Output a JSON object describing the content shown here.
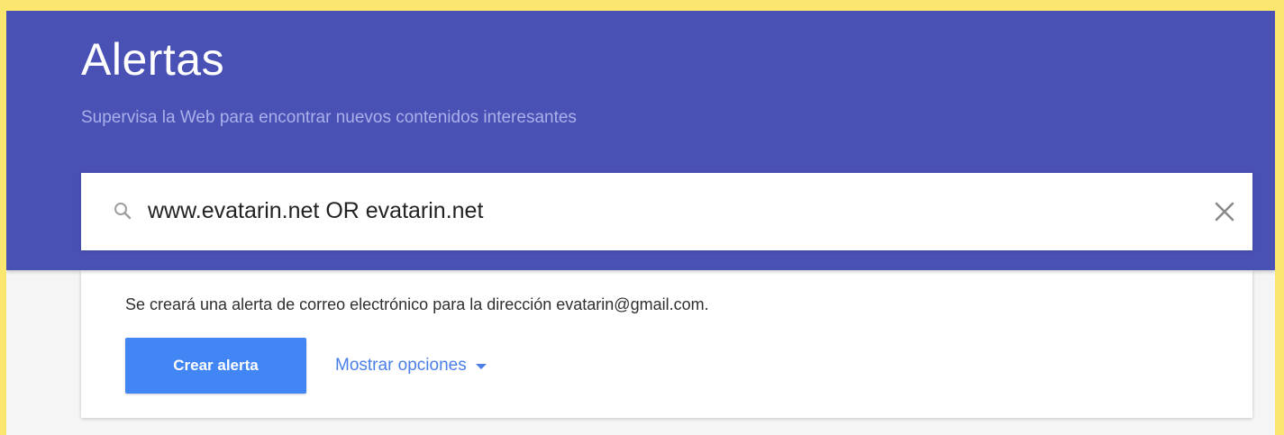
{
  "header": {
    "title": "Alertas",
    "subtitle": "Supervisa la Web para encontrar nuevos contenidos interesantes"
  },
  "search": {
    "value": "www.evatarin.net OR evatarin.net",
    "placeholder": "",
    "icon": "search-icon",
    "clear_icon": "close-icon"
  },
  "panel": {
    "notice": "Se creará una alerta de correo electrónico para la dirección evatarin@gmail.com.",
    "create_label": "Crear alerta",
    "options_label": "Mostrar opciones",
    "options_icon": "caret-down-icon"
  },
  "colors": {
    "header_bg": "#4a51b4",
    "accent_button": "#4285f4",
    "link": "#4a7fe8",
    "outer_border": "#fbe66f"
  }
}
